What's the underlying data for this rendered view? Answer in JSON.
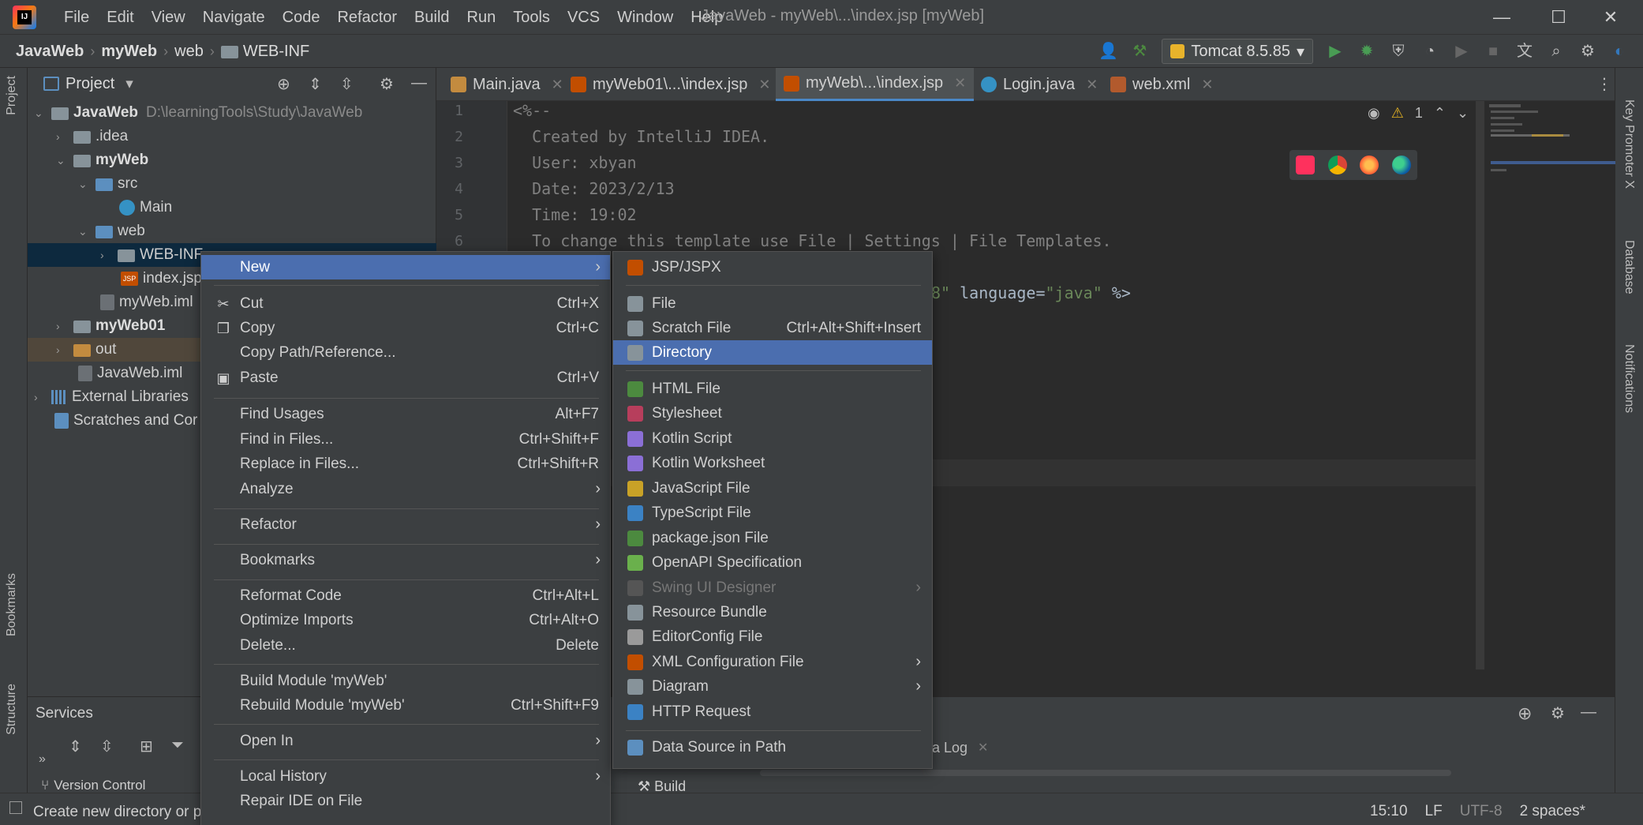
{
  "window": {
    "title": "JavaWeb - myWeb\\...\\index.jsp [myWeb]",
    "menu": [
      "File",
      "Edit",
      "View",
      "Navigate",
      "Code",
      "Refactor",
      "Build",
      "Run",
      "Tools",
      "VCS",
      "Window",
      "Help"
    ],
    "controls": {
      "minimize": "—",
      "maximize": "☐",
      "close": "✕"
    }
  },
  "navbar": {
    "breadcrumb": [
      "JavaWeb",
      "myWeb",
      "web",
      "WEB-INF"
    ],
    "run_config": "Tomcat 8.5.85"
  },
  "project": {
    "title": "Project",
    "tree": [
      {
        "label": "JavaWeb",
        "path": "D:\\learningTools\\Study\\JavaWeb",
        "arrow": "⌄"
      },
      {
        "label": ".idea",
        "arrow": "›"
      },
      {
        "label": "myWeb",
        "arrow": "⌄"
      },
      {
        "label": "src",
        "arrow": "⌄"
      },
      {
        "label": "Main"
      },
      {
        "label": "web",
        "arrow": "⌄"
      },
      {
        "label": "WEB-INF",
        "arrow": "›"
      },
      {
        "label": "index.jsp"
      },
      {
        "label": "myWeb.iml"
      },
      {
        "label": "myWeb01",
        "arrow": "›"
      },
      {
        "label": "out",
        "arrow": "›"
      },
      {
        "label": "JavaWeb.iml"
      },
      {
        "label": "External Libraries",
        "arrow": "›"
      },
      {
        "label": "Scratches and Cor"
      }
    ]
  },
  "services": {
    "title": "Services"
  },
  "left_strip": {
    "project": "Project",
    "bookmarks": "Bookmarks",
    "structure": "Structure"
  },
  "right_strip": {
    "key_promoter": "Key Promoter X",
    "database": "Database",
    "notifications": "Notifications"
  },
  "editor": {
    "tabs": [
      {
        "label": "Main.java",
        "icon": "java-j"
      },
      {
        "label": "myWeb01\\...\\index.jsp",
        "icon": "jsp"
      },
      {
        "label": "myWeb\\...\\index.jsp",
        "icon": "jsp",
        "active": true
      },
      {
        "label": "Login.java",
        "icon": "java-c"
      },
      {
        "label": "web.xml",
        "icon": "xml"
      }
    ],
    "line_numbers": [
      "1",
      "2",
      "3",
      "4",
      "5",
      "6"
    ],
    "lines": [
      "<%--",
      "  Created by IntelliJ IDEA.",
      "  User: xbyan",
      "  Date: 2023/2/13",
      "  Time: 19:02",
      "  To change this template use File | Settings | File Templates."
    ],
    "partial_line": {
      "a": "8\"",
      "b": " language=",
      "c": "\"java\"",
      "d": " %>"
    },
    "warnings": "1"
  },
  "context_menu": {
    "items": [
      {
        "label": "New",
        "submenu": true,
        "highlight": true
      },
      {
        "label": "Cut",
        "shortcut": "Ctrl+X",
        "icon": "✂"
      },
      {
        "label": "Copy",
        "shortcut": "Ctrl+C",
        "icon": "❐"
      },
      {
        "label": "Copy Path/Reference..."
      },
      {
        "label": "Paste",
        "shortcut": "Ctrl+V",
        "icon": "▣"
      },
      {
        "label": "Find Usages",
        "shortcut": "Alt+F7"
      },
      {
        "label": "Find in Files...",
        "shortcut": "Ctrl+Shift+F"
      },
      {
        "label": "Replace in Files...",
        "shortcut": "Ctrl+Shift+R"
      },
      {
        "label": "Analyze",
        "submenu": true
      },
      {
        "label": "Refactor",
        "submenu": true
      },
      {
        "label": "Bookmarks",
        "submenu": true
      },
      {
        "label": "Reformat Code",
        "shortcut": "Ctrl+Alt+L"
      },
      {
        "label": "Optimize Imports",
        "shortcut": "Ctrl+Alt+O"
      },
      {
        "label": "Delete...",
        "shortcut": "Delete"
      },
      {
        "label": "Build Module 'myWeb'"
      },
      {
        "label": "Rebuild Module 'myWeb'",
        "shortcut": "Ctrl+Shift+F9"
      },
      {
        "label": "Open In",
        "submenu": true
      },
      {
        "label": "Local History",
        "submenu": true
      },
      {
        "label": "Repair IDE on File"
      }
    ]
  },
  "new_submenu": {
    "items": [
      {
        "label": "JSP/JSPX",
        "color": "#c24e00"
      },
      {
        "label": "File",
        "color": "#87939a"
      },
      {
        "label": "Scratch File",
        "shortcut": "Ctrl+Alt+Shift+Insert",
        "color": "#87939a"
      },
      {
        "label": "Directory",
        "color": "#87939a",
        "highlight": true
      },
      {
        "label": "HTML File",
        "color": "#4c8a3f"
      },
      {
        "label": "Stylesheet",
        "color": "#b73e5c"
      },
      {
        "label": "Kotlin Script",
        "color": "#8b6fd6"
      },
      {
        "label": "Kotlin Worksheet",
        "color": "#8b6fd6"
      },
      {
        "label": "JavaScript File",
        "color": "#c9a227"
      },
      {
        "label": "TypeScript File",
        "color": "#3b82c4"
      },
      {
        "label": "package.json File",
        "color": "#4c8a3f"
      },
      {
        "label": "OpenAPI Specification",
        "color": "#6ab04c"
      },
      {
        "label": "Swing UI Designer",
        "submenu": true,
        "disabled": true,
        "color": "#555555"
      },
      {
        "label": "Resource Bundle",
        "color": "#87939a"
      },
      {
        "label": "EditorConfig File",
        "color": "#9a9a9a"
      },
      {
        "label": "XML Configuration File",
        "submenu": true,
        "color": "#c24e00"
      },
      {
        "label": "Diagram",
        "submenu": true,
        "color": "#87939a"
      },
      {
        "label": "HTTP Request",
        "color": "#3b82c4"
      },
      {
        "label": "Data Source in Path",
        "color": "#5c8fbf"
      }
    ]
  },
  "bottom": {
    "version_control": "Version Control",
    "build": "Build",
    "log_tab": "a Log"
  },
  "status": {
    "message": "Create new directory or p",
    "position": "15:10",
    "line_sep": "LF",
    "encoding": "UTF-8",
    "indent": "2 spaces*"
  }
}
